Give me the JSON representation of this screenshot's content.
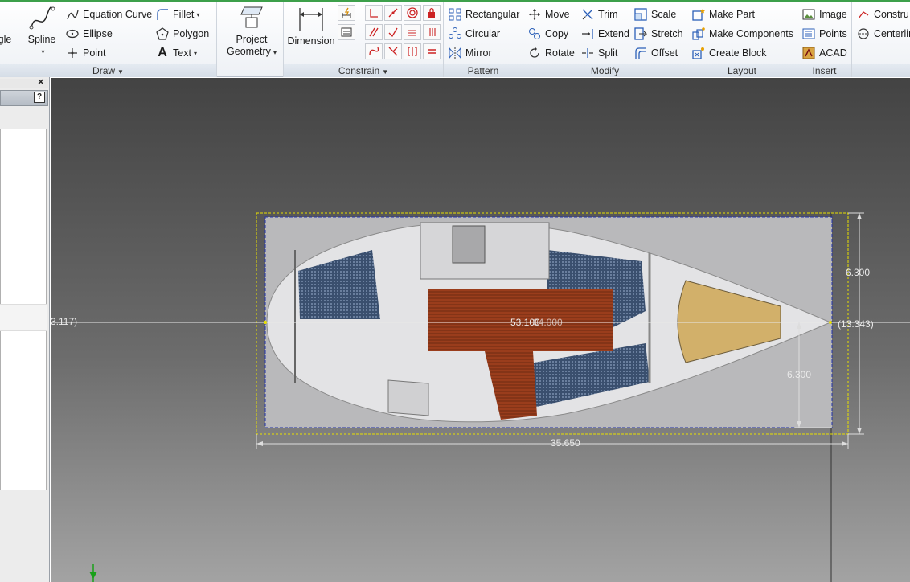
{
  "ribbon": {
    "draw": {
      "title": "Draw",
      "line_partial": "gle",
      "spline": "Spline",
      "equation_curve": "Equation Curve",
      "ellipse": "Ellipse",
      "point": "Point",
      "fillet": "Fillet",
      "polygon": "Polygon",
      "text": "Text"
    },
    "project_geometry": {
      "line1": "Project",
      "line2": "Geometry"
    },
    "constrain": {
      "title": "Constrain",
      "dimension": "Dimension"
    },
    "pattern": {
      "title": "Pattern",
      "rectangular": "Rectangular",
      "circular": "Circular",
      "mirror": "Mirror"
    },
    "modify": {
      "title": "Modify",
      "move": "Move",
      "copy": "Copy",
      "rotate": "Rotate",
      "trim": "Trim",
      "extend": "Extend",
      "split": "Split",
      "scale": "Scale",
      "stretch": "Stretch",
      "offset": "Offset"
    },
    "layout": {
      "title": "Layout",
      "make_part": "Make Part",
      "make_components": "Make Components",
      "create_block": "Create Block"
    },
    "insert": {
      "title": "Insert",
      "image": "Image",
      "points": "Points",
      "acad": "ACAD"
    },
    "format": {
      "construction_partial": "Constru",
      "centerline_partial": "Centerlin"
    }
  },
  "browser": {
    "close_glyph": "×",
    "help_glyph": "?"
  },
  "canvas": {
    "dims": {
      "left_ref": "3.117)",
      "right_ref": "(13.343)",
      "center_overlap": "53.100",
      "center_overlap2": "04.000",
      "vertical_top": "6.300",
      "vertical_bottom": "6.300",
      "width": "35.650"
    }
  },
  "colors": {
    "accent": "#3da04a",
    "constraint_red": "#cc2222",
    "sketch_yellow": "#e8e000",
    "dim_blue": "#2233aa"
  }
}
